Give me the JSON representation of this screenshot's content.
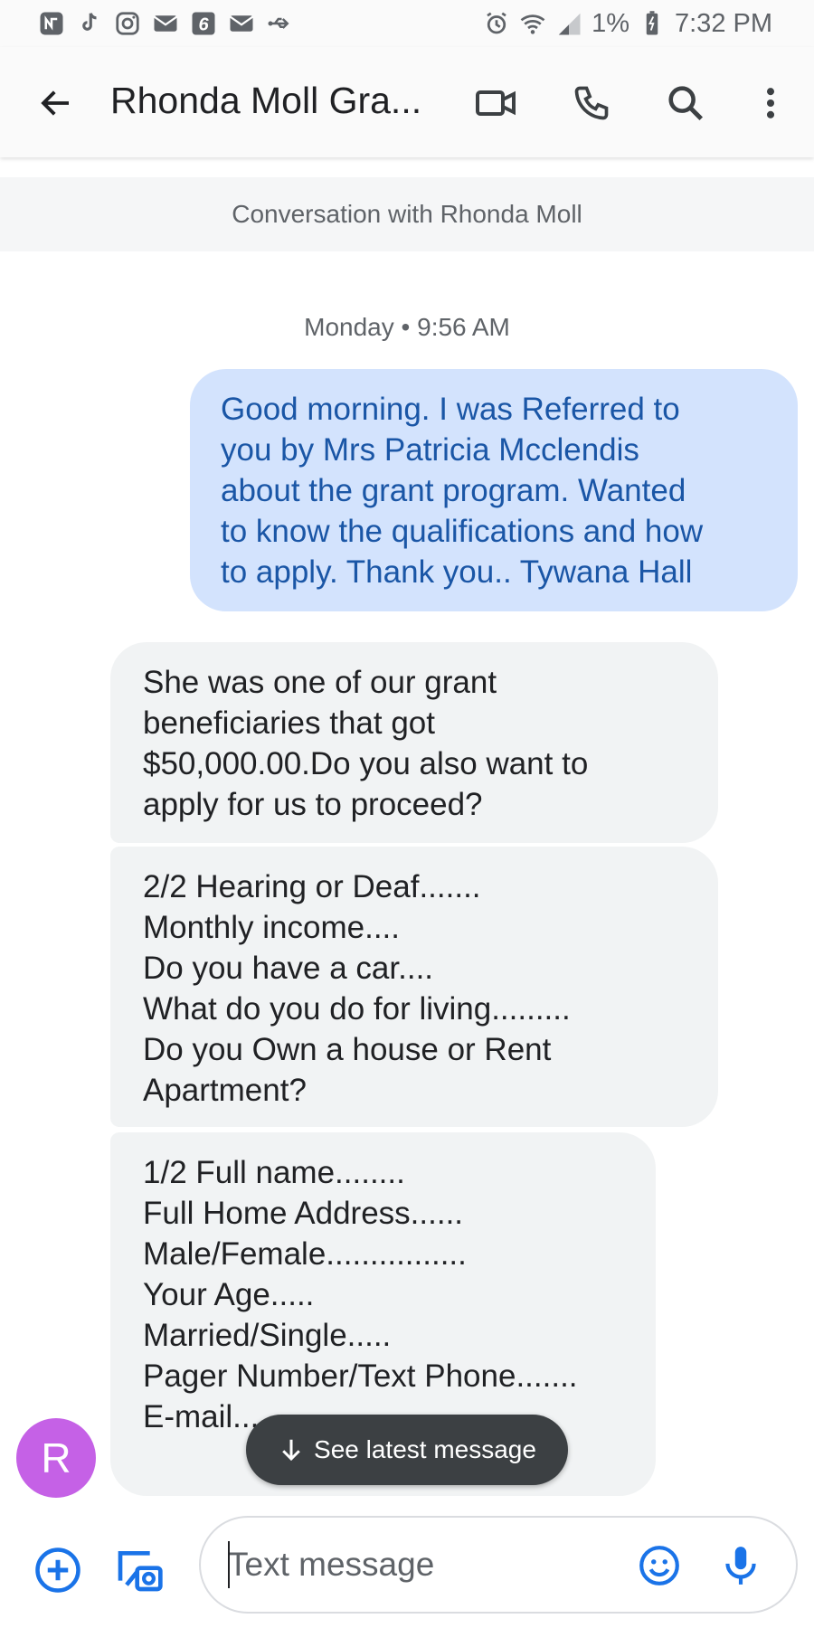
{
  "status_bar": {
    "battery": "1%",
    "time": "7:32 PM",
    "left_icons": [
      "app-n-icon",
      "tiktok-icon",
      "instagram-icon",
      "mail-icon",
      "six-icon",
      "mail-icon",
      "usb-icon"
    ],
    "right_icons": [
      "alarm-icon",
      "wifi-icon",
      "signal-icon",
      "battery-icon"
    ]
  },
  "header": {
    "title": "Rhonda Moll Gra...",
    "actions": [
      "video-call-icon",
      "phone-icon",
      "search-icon",
      "more-vert-icon"
    ]
  },
  "conversation": {
    "banner": "Conversation with Rhonda Moll",
    "timestamp": "Monday • 9:56 AM",
    "messages": [
      {
        "direction": "outgoing",
        "text": "Good morning. I was Referred to\nyou by Mrs Patricia Mcclendis\nabout the grant program. Wanted\nto know the qualifications and how\nto apply. Thank you..   Tywana Hall"
      },
      {
        "direction": "incoming",
        "text": "She was one of our grant\nbeneficiaries that got\n$50,000.00.Do you also want to\napply for us to proceed?"
      },
      {
        "direction": "incoming",
        "text": "2/2 Hearing or Deaf.......\nMonthly income....\nDo you have a car....\nWhat do you do for living.........\nDo you Own a house or Rent\nApartment?"
      },
      {
        "direction": "incoming",
        "text": "1/2 Full name........\nFull Home Address......\nMale/Female................\nYour Age.....\nMarried/Single.....\nPager Number/Text Phone.......\nE-mail........"
      }
    ],
    "avatar_letter": "R",
    "see_latest_label": "See latest message"
  },
  "compose": {
    "placeholder": "Text message",
    "value": ""
  },
  "colors": {
    "outgoing_bubble": "#d3e3fd",
    "outgoing_text": "#1a56a6",
    "incoming_bubble": "#f1f3f4",
    "avatar": "#c561e6",
    "accent_icon": "#1a73e8"
  }
}
